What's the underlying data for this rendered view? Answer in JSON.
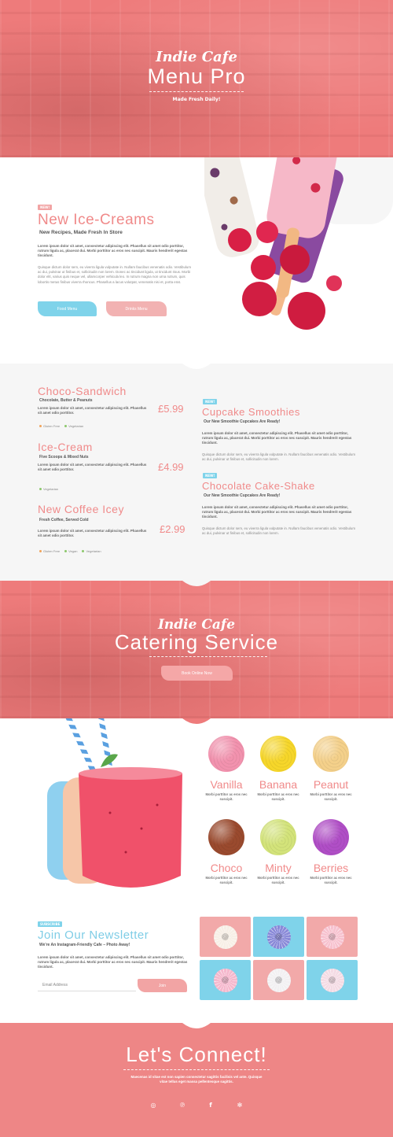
{
  "hero": {
    "script_title": "Indie Cafe",
    "title": "Menu Pro",
    "subtitle": "Made Fresh Daily!"
  },
  "intro": {
    "badge": "NEW!",
    "title": "New Ice-Creams",
    "subtitle": "New Recipes, Made Fresh In Store",
    "para1": "Lorem ipsum dolor sit amet, consectetur adipiscing elit. Phasellus sit amet odio porttitor, rutrum ligula ac, placerat dui. Morbi porttitor ac eros nec suscipit. Mauris hendrerit egestas tincidunt.",
    "para2": "Quisque dictum dolor sem, eu viverra ligula vulputate in. Nullam faucibus venenatis odio. Vestibulum ac dui, pulvinar ut finibus et, sollicitudin non lorem. Donec ac tincidunt ligula, ut tincidunt risus. Morbi dolor elit, varius quis neque vel, ullamcorper vehicula leo. In rutrum magna non urna rutrum, quis lobortis metus finibus viverra rhoncus. Phasellus a lacus volutpat, venenatis nisi et, porta erat.",
    "btn_food": "Food Menu",
    "btn_drinks": "Drinks Menu"
  },
  "menu": {
    "items": [
      {
        "name": "Choco-Sandwich",
        "sub": "Chocolate, Butter & Peanuts",
        "desc": "Lorem ipsum dolor sit amet, consectetur adipiscing elit. Phasellus sit amet odio porttitor.",
        "price": "£5.99",
        "tags": [
          {
            "label": "Gluten Free",
            "color": "#f0a35a"
          },
          {
            "label": "Vegetarian",
            "color": "#8cc86b"
          }
        ]
      },
      {
        "name": "Ice-Cream",
        "sub": "Five Scoops & Mixed Nuts",
        "desc": "Lorem ipsum dolor sit amet, consectetur adipiscing elit. Phasellus sit amet odio porttitor.",
        "price": "£4.99",
        "tags": [
          {
            "label": "Vegetarian",
            "color": "#8cc86b"
          }
        ]
      },
      {
        "name": "New Coffee Icey",
        "sub": "Fresh Coffee, Served Cold",
        "desc": "Lorem ipsum dolor sit amet, consectetur adipiscing elit. Phasellus sit amet odio porttitor.",
        "price": "£2.99",
        "tags": [
          {
            "label": "Gluten Free",
            "color": "#f0a35a"
          },
          {
            "label": "Vegan",
            "color": "#8cc86b"
          },
          {
            "label": "Vegetarian",
            "color": "#8cc86b"
          }
        ]
      }
    ],
    "specials": [
      {
        "badge": "NEW!",
        "name": "Cupcake Smoothies",
        "sub": "Our New Smoothie Cupcakes Are Ready!",
        "para1": "Lorem ipsum dolor sit amet, consectetur adipiscing elit. Phasellus sit amet odio porttitor, rutrum ligula ac, placerat dui. Morbi porttitor ac eros nec suscipit. Mauris hendrerit egestas tincidunt.",
        "para2": "Quisque dictum dolor sem, eu viverra ligula vulputate in. Nullam faucibus venenatis odio. Vestibulum ac dui, pulvinar ut finibus et, sollicitudin non lorem."
      },
      {
        "badge": "NEW!",
        "name": "Chocolate Cake-Shake",
        "sub": "Our New Smoothie Cupcakes Are Ready!",
        "para1": "Lorem ipsum dolor sit amet, consectetur adipiscing elit. Phasellus sit amet odio porttitor, rutrum ligula ac, placerat dui. Morbi porttitor ac eros nec suscipit. Mauris hendrerit egestas tincidunt.",
        "para2": "Quisque dictum dolor sem, eu viverra ligula vulputate in. Nullam faucibus venenatis odio. Vestibulum ac dui, pulvinar ut finibus et, sollicitudin non lorem."
      }
    ]
  },
  "catering": {
    "script_title": "Indie Cafe",
    "title": "Catering Service",
    "btn": "Book Online Now"
  },
  "flavors": [
    {
      "name": "Vanilla",
      "desc": "Morbi porttitor ac eros nec suscipit.",
      "color": "#f292ae"
    },
    {
      "name": "Banana",
      "desc": "Morbi porttitor ac eros nec suscipit.",
      "color": "#f6d62a"
    },
    {
      "name": "Peanut",
      "desc": "Morbi porttitor ac eros nec suscipit.",
      "color": "#f4d08a"
    },
    {
      "name": "Choco",
      "desc": "Morbi porttitor ac eros nec suscipit.",
      "color": "#9a4a2e"
    },
    {
      "name": "Minty",
      "desc": "Morbi porttitor ac eros nec suscipit.",
      "color": "#d3e37a"
    },
    {
      "name": "Berries",
      "desc": "Morbi porttitor ac eros nec suscipit.",
      "color": "#b04ec6"
    }
  ],
  "newsletter": {
    "badge": "SUBSCRIBE",
    "title": "Join Our Newsletter",
    "subtitle": "We're An Instagram-Friendly Cafe – Photo Away!",
    "para": "Lorem ipsum dolor sit amet, consectetur adipiscing elit. Phasellus sit amet odio porttitor, rutrum ligula ac, placerat dui. Morbi porttitor ac eros nec suscipit. Mauris hendrerit egestas tincidunt.",
    "email_placeholder": "Email Address",
    "btn": "Join",
    "tiles": [
      {
        "bg": "#f2a9a9",
        "donut": "#f7efe6"
      },
      {
        "bg": "#7fd3ea",
        "donut": "#8a8ad8"
      },
      {
        "bg": "#f2a9a9",
        "donut": "#f7c2cf"
      },
      {
        "bg": "#7fd3ea",
        "donut": "#f5b8cd"
      },
      {
        "bg": "#f2a9a9",
        "donut": "#f2f0f2"
      },
      {
        "bg": "#7fd3ea",
        "donut": "#f4dbe4"
      }
    ]
  },
  "connect": {
    "title": "Let's Connect!",
    "text": "Maecenas id vitae  est non sapien consectetur sagittis facilisis vel ante. Quisque vitae tellus eget massa pellentesque sagittis.",
    "socials": [
      {
        "icon": "instagram-icon",
        "glyph": "◎"
      },
      {
        "icon": "pinterest-icon",
        "glyph": "℗"
      },
      {
        "icon": "facebook-icon",
        "glyph": "f"
      },
      {
        "icon": "yelp-icon",
        "glyph": "✻"
      }
    ]
  },
  "colors": {
    "coral": "#ee7b7b",
    "pink_text": "#f08a8a",
    "blue": "#7fd3ea",
    "light_pink": "#f2b2b2"
  }
}
